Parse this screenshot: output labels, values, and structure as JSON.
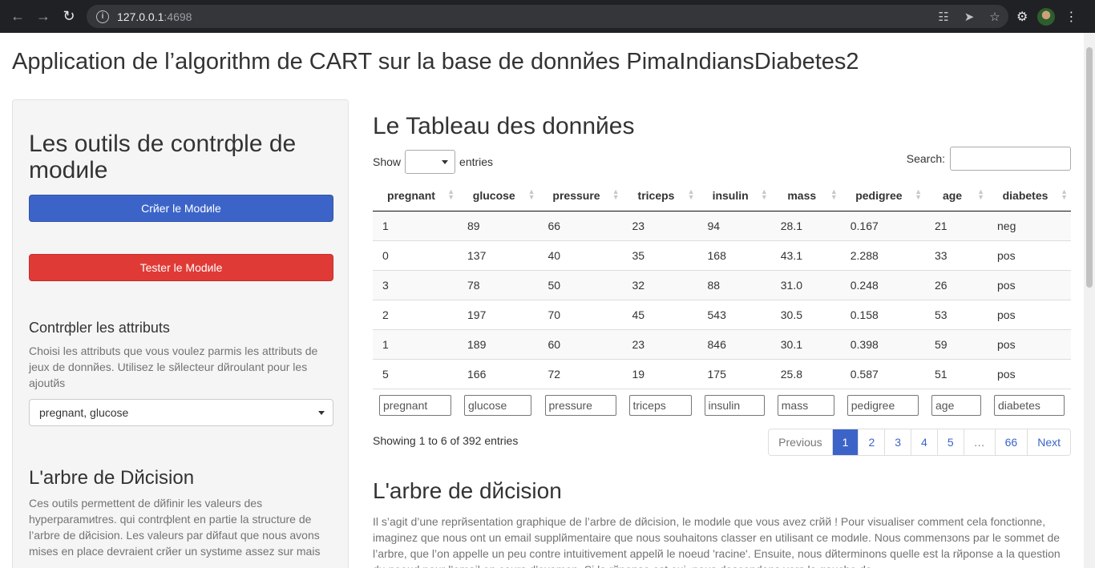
{
  "browser": {
    "url_host": "127.0.0.1",
    "url_port": ":4698"
  },
  "app_title": "Application de l’algorithm de CART sur la base de donnйes PimaIndiansDiabetes2",
  "sidebar": {
    "title": "Les outils de contrфle de modиle",
    "create_button": "Crйer le Modиle",
    "test_button": "Tester le Modиle",
    "attributes_title": "Contrфler les attributs",
    "attributes_help": "Choisi les attributs que vous voulez parmis les attributs de jeux de donnйes. Utilisez le sйlecteur dйroulant pour les ajoutйs",
    "attributes_selected": "pregnant, glucose",
    "tree_title": "L'arbre de Dйcision",
    "tree_help": "Ces outils permettent de dйfinir les valeurs des hyperparamиtres. qui contrфlent en partie la structure de l’arbre de dйcision. Les valeurs par dйfaut que nous avons mises en place devraient crйer un systиme assez sur mais"
  },
  "main": {
    "title": "Le Tableau des donnйes",
    "show_label": "Show",
    "entries_label": "entries",
    "search_label": "Search:",
    "columns": [
      "pregnant",
      "glucose",
      "pressure",
      "triceps",
      "insulin",
      "mass",
      "pedigree",
      "age",
      "diabetes"
    ],
    "rows": [
      [
        "1",
        "89",
        "66",
        "23",
        "94",
        "28.1",
        "0.167",
        "21",
        "neg"
      ],
      [
        "0",
        "137",
        "40",
        "35",
        "168",
        "43.1",
        "2.288",
        "33",
        "pos"
      ],
      [
        "3",
        "78",
        "50",
        "32",
        "88",
        "31.0",
        "0.248",
        "26",
        "pos"
      ],
      [
        "2",
        "197",
        "70",
        "45",
        "543",
        "30.5",
        "0.158",
        "53",
        "pos"
      ],
      [
        "1",
        "189",
        "60",
        "23",
        "846",
        "30.1",
        "0.398",
        "59",
        "pos"
      ],
      [
        "5",
        "166",
        "72",
        "19",
        "175",
        "25.8",
        "0.587",
        "51",
        "pos"
      ]
    ],
    "filter_placeholders": [
      "pregnant",
      "glucose",
      "pressure",
      "triceps",
      "insulin",
      "mass",
      "pedigree",
      "age",
      "diabetes"
    ],
    "info": "Showing 1 to 6 of 392 entries",
    "pagination": [
      "Previous",
      "1",
      "2",
      "3",
      "4",
      "5",
      "…",
      "66",
      "Next"
    ],
    "current_page": "1",
    "tree_title": "L'arbre de dйcision",
    "tree_paragraph": "Il s’agit d’une reprйsentation graphique de l’arbre de dйcision, le modиle que vous avez crйй ! Pour visualiser comment cela fonctionne, imaginez que nous ont un email supplйmentaire que nous souhaitons classer en utilisant ce modиle. Nous commenзons par le sommet de l’arbre, que l’on appelle un peu contre intuitivement appelй le noeud 'racine'. Ensuite, nous dйterminons quelle est la rйponse а la question du noeud pour l’email en cours d’examen. Si la rйponse est oui, nous descendons vers la gauche de"
  }
}
